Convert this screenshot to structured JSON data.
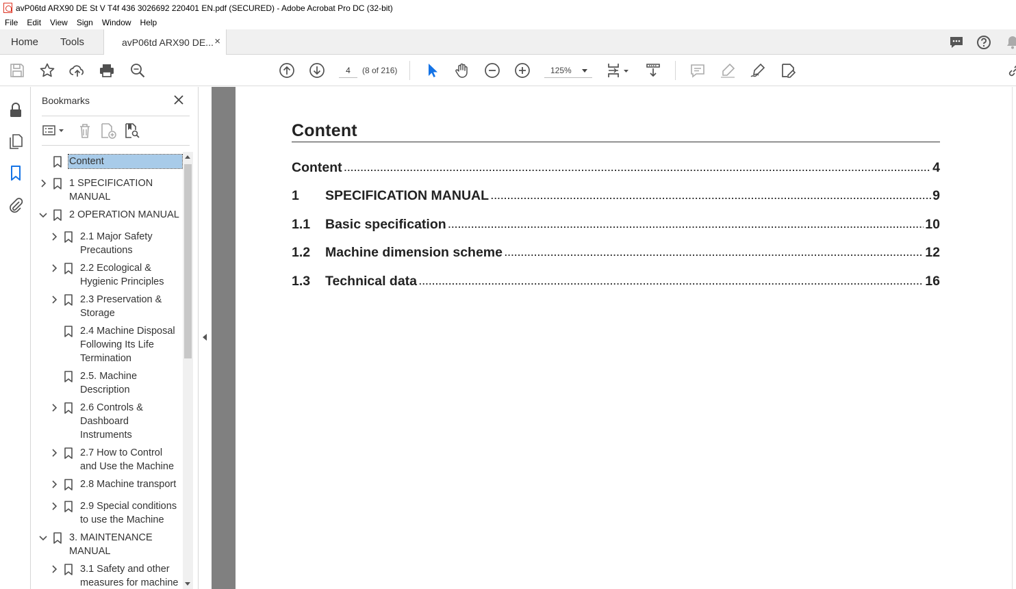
{
  "window": {
    "title": "avP06td ARX90 DE St V T4f 436 3026692 220401 EN.pdf (SECURED) - Adobe Acrobat Pro DC (32-bit)"
  },
  "menu": [
    "File",
    "Edit",
    "View",
    "Sign",
    "Window",
    "Help"
  ],
  "tabs": {
    "home": "Home",
    "tools": "Tools",
    "document": "avP06td ARX90 DE...",
    "close": "×"
  },
  "toolbar": {
    "page_current": "4",
    "page_count": "(8 of 216)",
    "zoom": "125%"
  },
  "bookmarks": {
    "title": "Bookmarks",
    "items": [
      {
        "label": "Content",
        "selected": true
      },
      {
        "label": "1 SPECIFICATION MANUAL"
      },
      {
        "label": "2 OPERATION MANUAL"
      },
      {
        "label": "2.1 Major Safety Precautions"
      },
      {
        "label": "2.2 Ecological & Hygienic Principles"
      },
      {
        "label": "2.3 Preservation & Storage"
      },
      {
        "label": "2.4 Machine Disposal Following Its Life Termination"
      },
      {
        "label": "2.5. Machine Description"
      },
      {
        "label": "2.6 Controls & Dashboard Instruments"
      },
      {
        "label": "2.7 How to Control and Use the Machine"
      },
      {
        "label": "2.8 Machine transport"
      },
      {
        "label": "2.9 Special conditions to use the Machine"
      },
      {
        "label": "3. MAINTENANCE MANUAL"
      },
      {
        "label": "3.1 Safety and other measures for machine"
      }
    ]
  },
  "document": {
    "heading": "Content",
    "toc": [
      {
        "num": "",
        "title": "Content",
        "page": "4"
      },
      {
        "num": "1",
        "title": "SPECIFICATION MANUAL",
        "page": "9"
      },
      {
        "num": "1.1",
        "title": "Basic specification",
        "page": "10"
      },
      {
        "num": "1.2",
        "title": "Machine dimension scheme",
        "page": "12"
      },
      {
        "num": "1.3",
        "title": "Technical data",
        "page": "16"
      }
    ],
    "dots": "......................................................................................................................................................................................................................"
  },
  "icons": {
    "accent": "#1473e6",
    "icon_gray": "#505050"
  }
}
